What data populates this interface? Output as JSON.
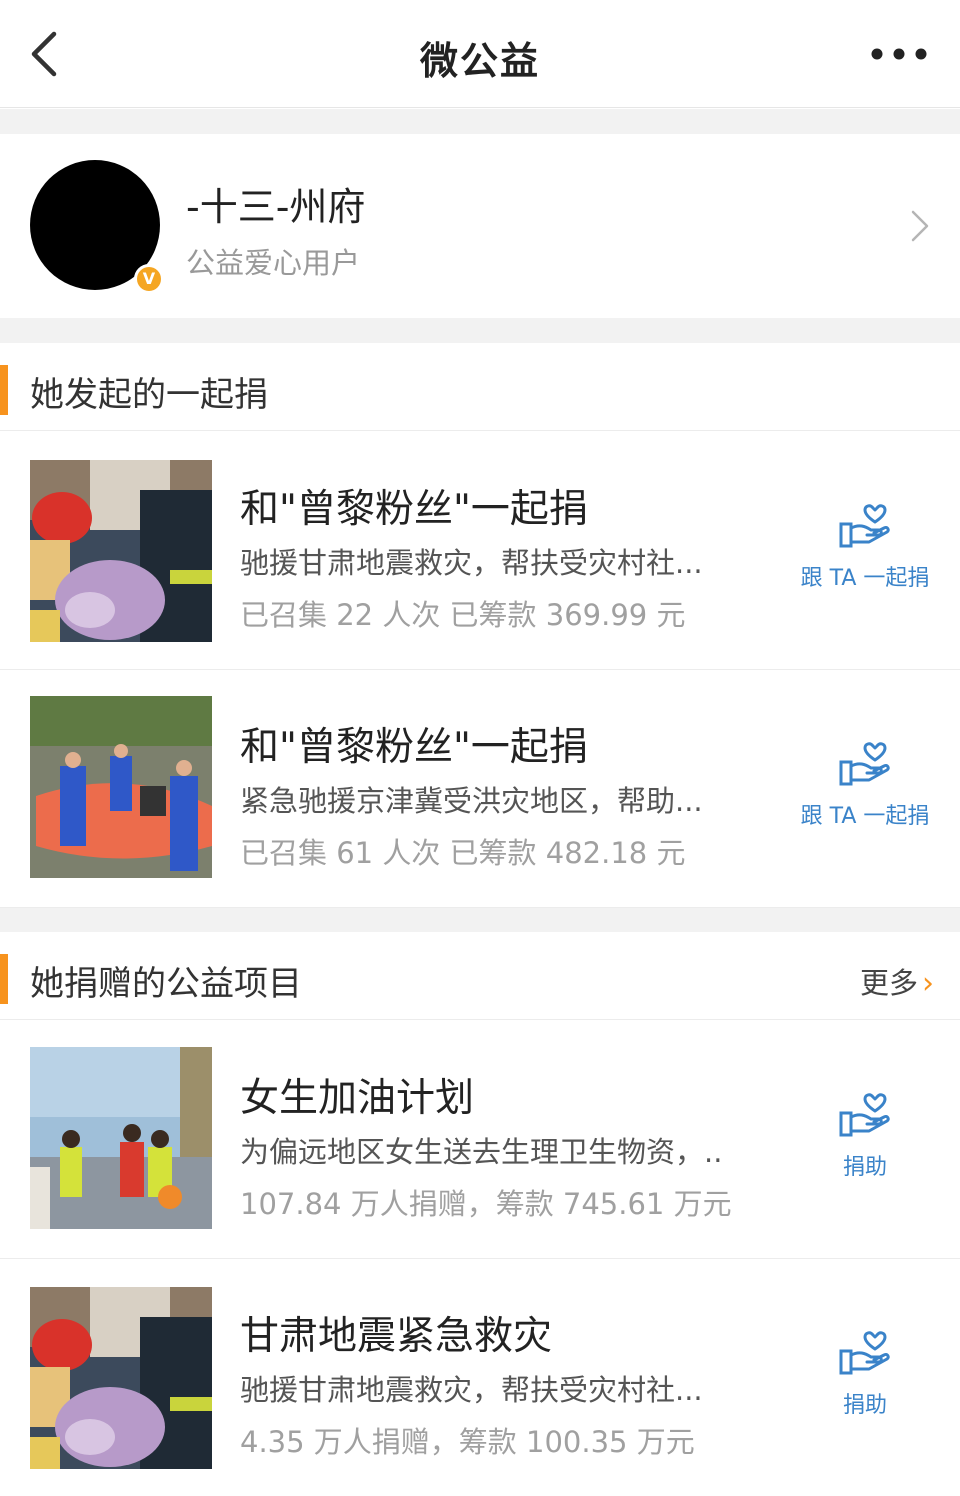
{
  "nav": {
    "title": "微公益"
  },
  "profile": {
    "name": "-十三-州府",
    "subtitle": "公益爱心用户",
    "badge": "V"
  },
  "section_initiated": {
    "header": "她发起的一起捐",
    "items": [
      {
        "title": "和\"曾黎粉丝\"一起捐",
        "desc": "驰援甘肃地震救灾，帮扶受灾村社...",
        "stat": "已召集 22 人次 已筹款 369.99 元",
        "action": "跟 TA 一起捐"
      },
      {
        "title": "和\"曾黎粉丝\"一起捐",
        "desc": "紧急驰援京津冀受洪灾地区，帮助...",
        "stat": "已召集 61 人次 已筹款 482.18 元",
        "action": "跟 TA 一起捐"
      }
    ]
  },
  "section_donated": {
    "header": "她捐赠的公益项目",
    "more": "更多",
    "items": [
      {
        "title": "女生加油计划",
        "desc": "为偏远地区女生送去生理卫生物资，..",
        "stat": "107.84 万人捐赠，筹款 745.61 万元",
        "action": "捐助"
      },
      {
        "title": "甘肃地震紧急救灾",
        "desc": "驰援甘肃地震救灾，帮扶受灾村社...",
        "stat": "4.35 万人捐赠，筹款 100.35 万元",
        "action": "捐助"
      }
    ]
  },
  "colors": {
    "accent": "#f7931e",
    "link": "#3a83c9",
    "badge": "#f5a623"
  }
}
